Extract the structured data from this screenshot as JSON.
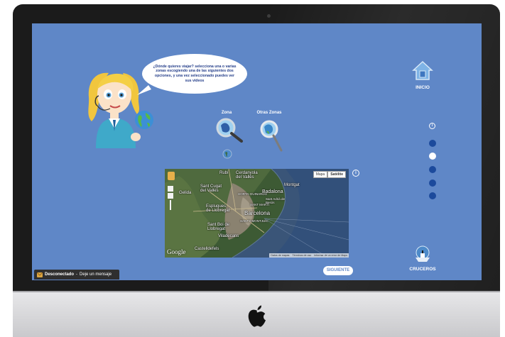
{
  "bubble": {
    "text": "¿Dónde quieres viajar? selecciona una o varias zonas escogiendo una de las siguientes dos opciones, y una vez seleccionado puedes ver sus videos"
  },
  "options": {
    "zona_label": "Zona",
    "otras_zonas_label": "Otras Zonas"
  },
  "map": {
    "tab_mapa": "Mapa",
    "tab_satelite": "Satélite",
    "labels": {
      "rubi": "Rubí",
      "cerdanyola": "Cerdanyola del Vallès",
      "montgat": "Montgat",
      "badalona": "Badalona",
      "sant_cugat": "Sant Cugat del Vallès",
      "sant_marti": "SANT MARTÍ",
      "sant_adria": "Sant Adrià de Besòs",
      "barcelona": "Barcelona",
      "esplugues": "Esplugues de Llobregat",
      "sant_boi": "Sant Boi de Llobregat",
      "viladecans": "Viladecans",
      "castelldefels": "Castelldefels",
      "gelida": "Gelida",
      "montjuic": "SANTS-MONTJUÏC",
      "horta": "HORTA-GUINARDÓ"
    },
    "google": "Google",
    "foot_datos": "Datos de mapas",
    "foot_terminos": "Términos de uso",
    "foot_error": "Informar de un error de Maps"
  },
  "nav": {
    "inicio": "INICIO",
    "cruceros": "CRUCEROS",
    "siguiente": "SIGUIENTE",
    "info_icon": "i",
    "dots_count": 5,
    "active_dot": 1
  },
  "chat": {
    "status": "Desconectado",
    "separator": "-",
    "message": "Deje un mensaje"
  },
  "colors": {
    "screen_bg": "#5f87c7",
    "dot": "#1c4a9c",
    "dot_active": "#ffffff",
    "bezel": "#1b1b1b"
  }
}
